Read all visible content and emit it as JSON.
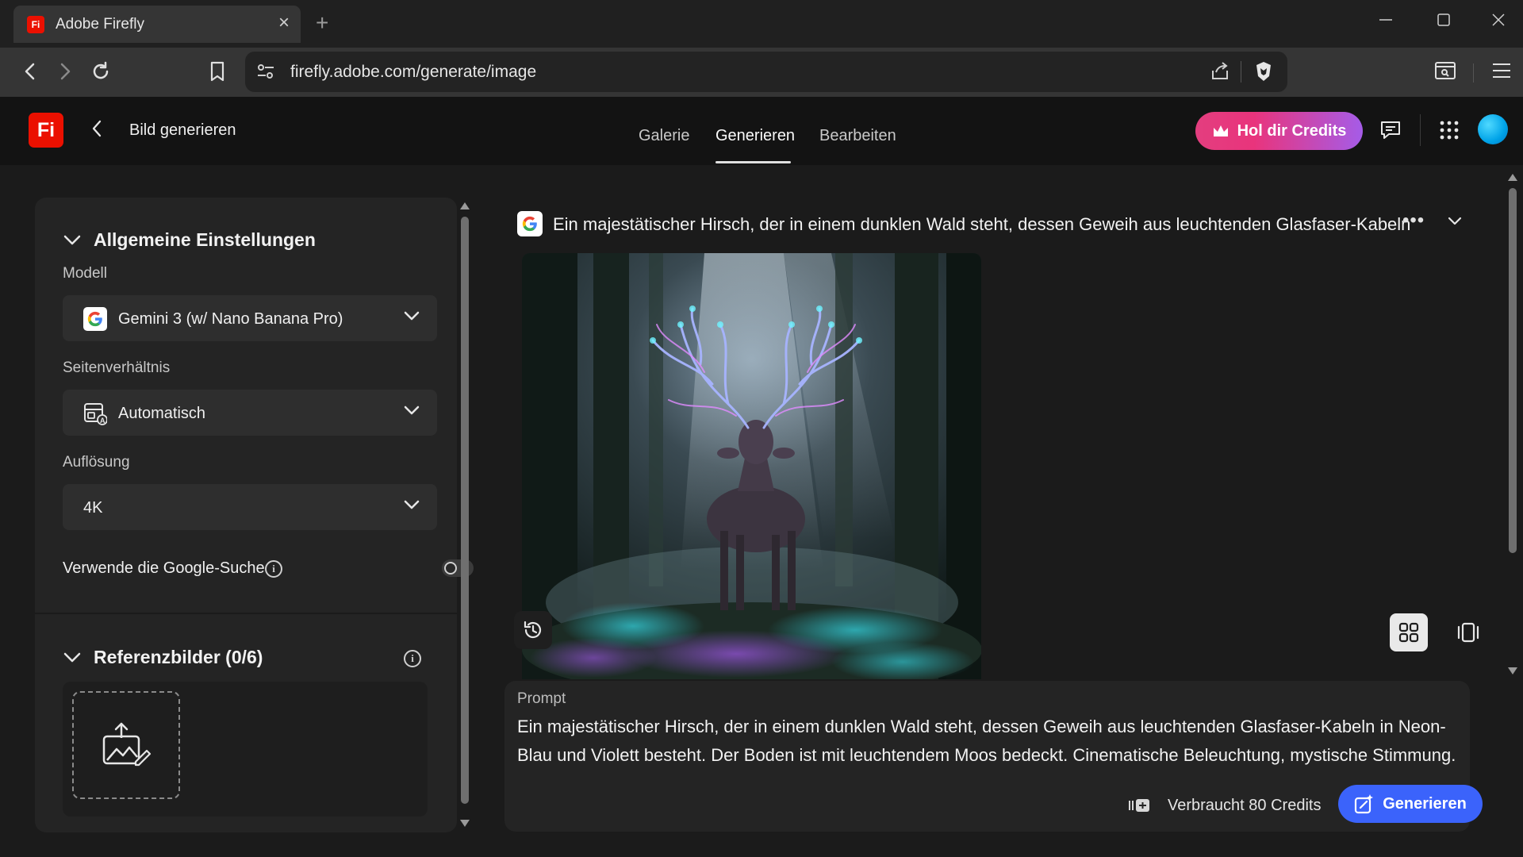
{
  "browser": {
    "tab_title": "Adobe Firefly",
    "tab_favicon_text": "Fi",
    "url": "firefly.adobe.com/generate/image"
  },
  "header": {
    "logo_text": "Fi",
    "page_title": "Bild generieren",
    "tabs": [
      {
        "label": "Galerie",
        "active": false
      },
      {
        "label": "Generieren",
        "active": true
      },
      {
        "label": "Bearbeiten",
        "active": false
      }
    ],
    "credits_button": "Hol dir Credits"
  },
  "settings": {
    "section_title": "Allgemeine Einstellungen",
    "model_label": "Modell",
    "model_value": "Gemini 3 (w/ Nano Banana Pro)",
    "aspect_label": "Seitenverhältnis",
    "aspect_value": "Automatisch",
    "resolution_label": "Auflösung",
    "resolution_value": "4K",
    "google_search_label": "Verwende die Google-Suche",
    "google_search_enabled": false
  },
  "references": {
    "section_title": "Referenzbilder (0/6)"
  },
  "main": {
    "prompt_title": "Ein majestätischer Hirsch, der in einem dunklen Wald steht, dessen Geweih aus leuchtenden Glasfaser-Kabeln",
    "image_description": "Generiertes Bild"
  },
  "prompt_card": {
    "label": "Prompt",
    "text": "Ein majestätischer Hirsch, der in einem dunklen Wald steht, dessen Geweih aus leuchtenden Glasfaser-Kabeln in Neon-Blau und Violett besteht. Der Boden ist mit leuchtendem Moos bedeckt. Cinematische Beleuchtung, mystische Stimmung.",
    "credits_text": "Verbraucht 80 Credits",
    "generate_button": "Generieren"
  },
  "colors": {
    "accent_blue": "#3b63fb",
    "brand_red": "#eb1000",
    "credits_gradient_start": "#e33e7f",
    "credits_gradient_end": "#a55ce8"
  }
}
